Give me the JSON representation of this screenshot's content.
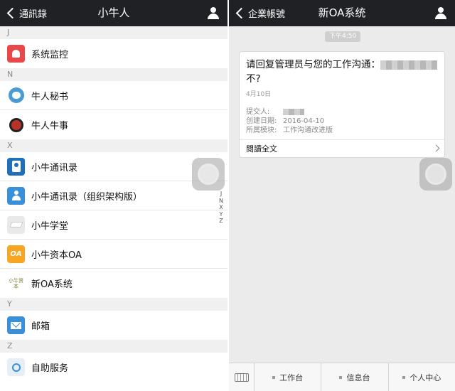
{
  "left": {
    "nav": {
      "back_label": "通訊錄",
      "title": "小牛人"
    },
    "sections": [
      {
        "letter": "J",
        "items": [
          {
            "label": "系统监控",
            "icon": "bell-icon"
          }
        ]
      },
      {
        "letter": "N",
        "items": [
          {
            "label": "牛人秘书",
            "icon": "chat-bubble-icon"
          },
          {
            "label": "牛人牛事",
            "icon": "cow-mascot-icon"
          }
        ]
      },
      {
        "letter": "X",
        "items": [
          {
            "label": "小牛通讯录",
            "icon": "contact-book-icon"
          },
          {
            "label": "小牛通讯录（组织架构版）",
            "icon": "person-icon"
          },
          {
            "label": "小牛学堂",
            "icon": "graduation-cap-icon"
          },
          {
            "label": "小牛资本OA",
            "icon": "oa-icon",
            "icon_text": "OA"
          },
          {
            "label": "新OA系统",
            "icon": "company-logo-icon",
            "icon_text": "小牛资本"
          }
        ]
      },
      {
        "letter": "Y",
        "items": [
          {
            "label": "邮箱",
            "icon": "mail-icon"
          }
        ]
      },
      {
        "letter": "Z",
        "items": [
          {
            "label": "自助服务",
            "icon": "self-service-icon"
          }
        ]
      }
    ],
    "index": [
      "J",
      "N",
      "X",
      "Y",
      "Z"
    ]
  },
  "right": {
    "nav": {
      "back_label": "企業帳號",
      "title": "新OA系统"
    },
    "time": "下午4:50",
    "card": {
      "title": "请回复管理员与您的工作沟通：",
      "title_tail": "不?",
      "date": "4月10日",
      "submitter_label": "提交人:",
      "created_label": "创建日期:",
      "created_value": "2016-04-10",
      "module_label": "所属模块:",
      "module_value": "工作沟通改进版",
      "read_full": "閱讀全文"
    },
    "tabs": [
      "工作台",
      "信息台",
      "个人中心"
    ]
  }
}
